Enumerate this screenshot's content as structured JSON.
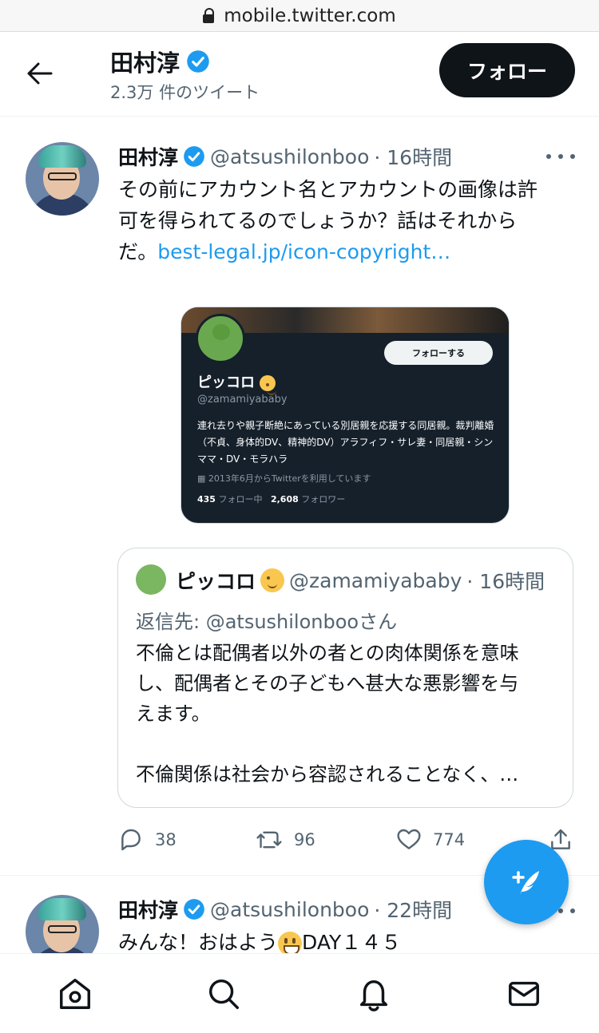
{
  "browser": {
    "url": "mobile.twitter.com"
  },
  "header": {
    "name": "田村淳",
    "tweet_count": "2.3万 件のツイート",
    "follow_label": "フォロー"
  },
  "tweet1": {
    "name": "田村淳",
    "handle": "@atsushilonboo",
    "time": "· 16時間",
    "text_line1": "その前にアカウント名とアカウントの画像は許",
    "text_line2": "可を得られてるのでしょうか？話はそれから",
    "text_line3_prefix": "だ。",
    "link": "best-legal.jp/icon-copyright…",
    "image_card": {
      "follow_label": "フォローする",
      "name": "ピッコロ",
      "handle": "@zamamiyababy",
      "bio": "連れ去りや親子断絶にあっている別居親を応援する同居親。裁判離婚（不貞、身体的DV、精神的DV）アラフィフ・サレ妻・同居親・シンママ・DV・モラハラ",
      "joined": "2013年6月からTwitterを利用しています",
      "following_count": "435",
      "following_label": "フォロー中",
      "followers_count": "2,608",
      "followers_label": "フォロワー"
    },
    "quote": {
      "name": "ピッコロ",
      "handle": "@zamamiyababy",
      "time": "· 16時間",
      "reply_to": "返信先: @atsushilonbooさん",
      "text_line1": "不倫とは配偶者以外の者との肉体関係を意味",
      "text_line2": "し、配偶者とその子どもへ甚大な悪影響を与",
      "text_line3": "えます。",
      "text_line4": "不倫関係は社会から容認されることなく、…"
    },
    "actions": {
      "reply_count": "38",
      "retweet_count": "96",
      "like_count": "774"
    }
  },
  "tweet2": {
    "name": "田村淳",
    "handle": "@atsushilonboo",
    "time": "· 22時間",
    "text_prefix": "みんな！おはよう",
    "text_suffix": "DAY１４５"
  },
  "colors": {
    "accent": "#1d9bf0",
    "text": "#0f1419",
    "secondary": "#536471"
  },
  "icons": [
    "back-arrow-icon",
    "verified-badge-icon",
    "more-icon",
    "reply-icon",
    "retweet-icon",
    "like-icon",
    "share-icon",
    "compose-icon",
    "home-icon",
    "search-icon",
    "notifications-icon",
    "messages-icon"
  ]
}
